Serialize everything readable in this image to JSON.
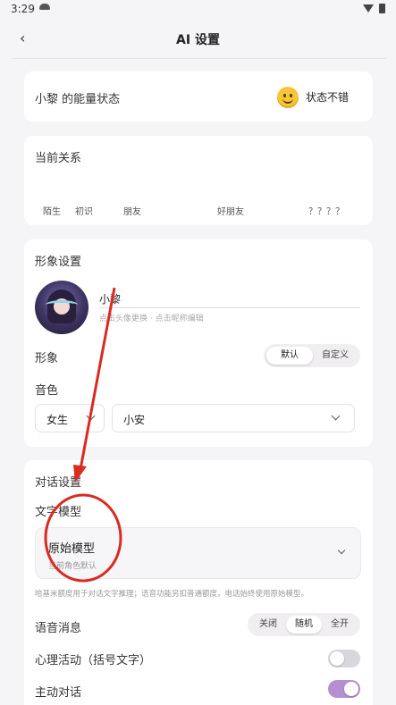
{
  "status_bar": {
    "time": "3:29"
  },
  "header": {
    "title": "AI 设置"
  },
  "energy": {
    "label": "小黎 的能量状态",
    "status": "状态不错",
    "icon": "smile-emoji-icon"
  },
  "relationship": {
    "title": "当前关系",
    "stages": [
      "陌生",
      "初识",
      "朋友",
      "好朋友",
      "？？？？"
    ]
  },
  "appearance": {
    "title": "形象设置",
    "nickname": "小黎",
    "hint": "点击头像更换 · 点击昵称编辑",
    "image_label": "形象",
    "image_options": [
      "默认",
      "自定义"
    ],
    "image_selected": "默认",
    "voice_label": "音色",
    "voice_gender": "女生",
    "voice_name": "小安"
  },
  "dialog": {
    "title": "对话设置",
    "model_label": "文字模型",
    "model_name": "原始模型",
    "model_sub": "当前角色默认",
    "note": "哈基米额度用于对话文字推理；语音功能另扣普通额度，电话始终使用原始模型。",
    "voice_msg_label": "语音消息",
    "voice_msg_options": [
      "关闭",
      "随机",
      "全开"
    ],
    "voice_msg_selected": "随机",
    "inner_label": "心理活动（括号文字）",
    "inner_on": false,
    "proactive_label": "主动对话",
    "proactive_on": true
  },
  "colors": {
    "accent": "#b58fd1",
    "annotation": "#d92b22",
    "toggle_off": "#d8d7db"
  }
}
